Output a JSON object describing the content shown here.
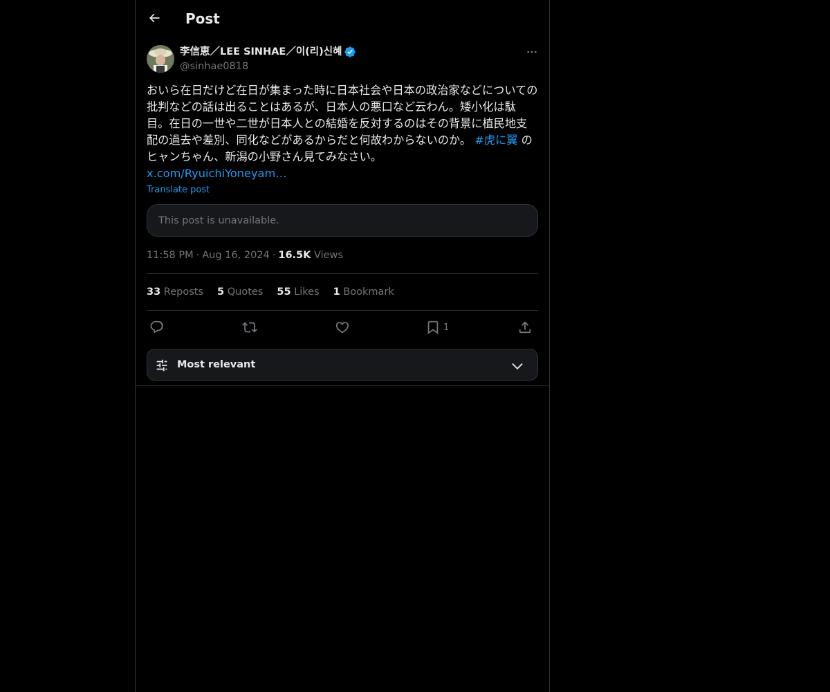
{
  "header": {
    "back_icon": "arrow-left-icon",
    "title": "Post"
  },
  "post": {
    "author_name": "李信恵／LEE SINHAE／이(리)신혜",
    "verified_icon": "verified-badge-icon",
    "handle": "@sinhae0818",
    "more_icon": "more-horizontal-icon",
    "text_main": "おいら在日だけど在日が集まった時に日本社会や日本の政治家などについての批判などの話は出ることはあるが、日本人の悪口など云わん。矮小化は駄目。在日の一世や二世が日本人との結婚を反対するのはその背景に植民地支配の過去や差別、同化などがあるからだと何故わからないのか。",
    "hashtag": "#虎に翼",
    "text_after_hashtag": "のヒャンちゃん、新潟の小野さん見てみなさい。",
    "link": "x.com/RyuichiYoneyam…",
    "translate_label": "Translate post",
    "quote_unavailable": "This post is unavailable.",
    "time": "11:58 PM",
    "date": "Aug 16, 2024",
    "views_count": "16.5K",
    "views_label": "Views",
    "stats": {
      "reposts_count": "33",
      "reposts_label": "Reposts",
      "quotes_count": "5",
      "quotes_label": "Quotes",
      "likes_count": "55",
      "likes_label": "Likes",
      "bookmarks_count": "1",
      "bookmarks_label": "Bookmark"
    },
    "actions": {
      "reply_icon": "reply-icon",
      "repost_icon": "repost-icon",
      "like_icon": "heart-icon",
      "bookmark_icon": "bookmark-icon",
      "bookmark_count": "1",
      "share_icon": "share-icon"
    }
  },
  "replies_sort": {
    "icon": "sliders-icon",
    "label": "Most relevant",
    "chevron_icon": "chevron-down-icon"
  },
  "colors": {
    "background": "#000000",
    "text_primary": "#e7e9ea",
    "text_secondary": "#71767b",
    "accent": "#1d9bf0",
    "border": "#2f3336"
  }
}
